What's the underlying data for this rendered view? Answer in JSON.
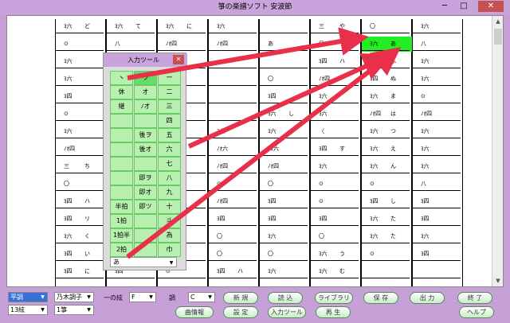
{
  "window": {
    "title": "箏の楽譜ソフト 安波節",
    "minimize": "─",
    "maximize": "□",
    "close": "✕"
  },
  "score": {
    "columns": [
      {
        "cells": [
          [
            "ﾖ六",
            "ど"
          ],
          [
            "⊙",
            ""
          ],
          [
            "ﾖ六",
            ""
          ],
          [
            "ﾖ六",
            ""
          ],
          [
            "ﾖ四",
            ""
          ],
          [
            "⊙",
            ""
          ],
          [
            "ﾖ六",
            ""
          ],
          [
            "ﾉｵ四",
            ""
          ],
          [
            "三",
            "ち"
          ],
          [
            "〇",
            ""
          ],
          [
            "ﾖ四",
            "ハ"
          ],
          [
            "ﾖ四",
            "リ"
          ],
          [
            "ﾖ六",
            "く"
          ],
          [
            "ﾖ四",
            "い"
          ],
          [
            "ﾖ四",
            "に"
          ]
        ]
      },
      {
        "cells": [
          [
            "ﾖ六",
            "て"
          ],
          [
            "八",
            ""
          ],
          [
            "ﾖ六",
            ""
          ],
          [
            "",
            ""
          ],
          [
            "",
            ""
          ],
          [
            "",
            ""
          ],
          [
            "",
            ""
          ],
          [
            "",
            ""
          ],
          [
            "",
            ""
          ],
          [
            "",
            ""
          ],
          [
            "",
            ""
          ],
          [
            "",
            ""
          ],
          [
            "",
            ""
          ],
          [
            "",
            ""
          ],
          [
            "ﾖ四",
            ""
          ]
        ]
      },
      {
        "cells": [
          [
            "ﾖ六",
            "に"
          ],
          [
            "ﾉｵ四",
            ""
          ],
          [
            "ﾖ六",
            ""
          ],
          [
            "ﾖ四",
            ""
          ],
          [
            "ﾖ四",
            ""
          ],
          [
            "",
            ""
          ],
          [
            "ﾖ四",
            ""
          ],
          [
            "",
            ""
          ],
          [
            "〈",
            ""
          ],
          [
            "⊙",
            ""
          ],
          [
            "⊙",
            ""
          ],
          [
            "ﾖ六",
            ""
          ],
          [
            "ﾖ六",
            ""
          ],
          [
            "⊙",
            ""
          ],
          [
            "⊙",
            ""
          ]
        ]
      },
      {
        "cells": [
          [
            "ﾖ六",
            ""
          ],
          [
            "ﾉｵ四",
            ""
          ],
          [
            "",
            ""
          ],
          [
            "",
            ""
          ],
          [
            "",
            ""
          ],
          [
            "",
            ""
          ],
          [
            "ﾖ六",
            ""
          ],
          [
            "ﾉｵ六",
            ""
          ],
          [
            "ﾉｵ四",
            ""
          ],
          [
            "⊙",
            ""
          ],
          [
            "ﾉｵ四",
            ""
          ],
          [
            "ﾖ四",
            ""
          ],
          [
            "〇",
            ""
          ],
          [
            "〇",
            ""
          ],
          [
            "ﾖ四",
            "ハ"
          ]
        ]
      },
      {
        "cells": [
          [
            "",
            ""
          ],
          [
            "あ",
            ""
          ],
          [
            "",
            ""
          ],
          [
            "〇",
            ""
          ],
          [
            "ﾖ四",
            ""
          ],
          [
            "ﾖ六",
            "し"
          ],
          [
            "ﾖ六",
            ""
          ],
          [
            "ﾉｵ六",
            ""
          ],
          [
            "ﾉｵ四",
            ""
          ],
          [
            "〇",
            ""
          ],
          [
            "ﾖ四",
            ""
          ],
          [
            "ﾖ四",
            ""
          ],
          [
            "ﾖ六",
            ""
          ],
          [
            "〇",
            ""
          ],
          [
            "ﾖ六",
            ""
          ]
        ]
      },
      {
        "cells": [
          [
            "三",
            "や"
          ],
          [
            "〇",
            ""
          ],
          [
            "ﾖ四",
            "ハ"
          ],
          [
            "ﾉｵ四",
            ""
          ],
          [
            "ﾖ六",
            ""
          ],
          [
            "ﾖ六",
            ""
          ],
          [
            "〈",
            ""
          ],
          [
            "ﾖ四",
            "す"
          ],
          [
            "ﾖ六",
            ""
          ],
          [
            "⊙",
            ""
          ],
          [
            "⊙",
            ""
          ],
          [
            "ﾖ四",
            ""
          ],
          [
            "〇",
            ""
          ],
          [
            "ﾖ六",
            "う"
          ],
          [
            "ﾖ六",
            "む"
          ]
        ]
      },
      {
        "cells": [
          [
            "〇",
            ""
          ],
          [
            "ﾖ六",
            "あ"
          ],
          [
            "ﾖ六",
            "ふ"
          ],
          [
            "ﾖ四",
            "ぬ"
          ],
          [
            "ﾖ六",
            "ま"
          ],
          [
            "ﾉｵ四",
            "は"
          ],
          [
            "ﾖ六",
            "つ"
          ],
          [
            "ﾖ六",
            "え"
          ],
          [
            "ﾖ六",
            "ん"
          ],
          [
            "⊙",
            ""
          ],
          [
            "ﾖ四",
            "し"
          ],
          [
            "ﾖ六",
            "た"
          ],
          [
            "ﾖ六",
            "た"
          ],
          [
            "⊙",
            ""
          ],
          [
            "",
            ""
          ]
        ]
      },
      {
        "cells": [
          [
            "ﾖ六",
            ""
          ],
          [
            "八",
            ""
          ],
          [
            "ﾖ六",
            ""
          ],
          [
            "ﾖ六",
            ""
          ],
          [
            "⊙",
            ""
          ],
          [
            "ﾉｵ四",
            ""
          ],
          [
            "ﾖ六",
            ""
          ],
          [
            "ﾖ六",
            ""
          ],
          [
            "ﾖ六",
            ""
          ],
          [
            "八",
            ""
          ],
          [
            "ﾖ四",
            ""
          ],
          [
            "ﾖ四",
            ""
          ],
          [
            "ﾖ六",
            ""
          ],
          [
            "ﾖ四",
            ""
          ],
          [
            "",
            ""
          ]
        ]
      }
    ],
    "highlight_note": "ﾖ六  あ"
  },
  "tool_panel": {
    "title": "入力ツール",
    "close": "✕",
    "grid": [
      [
        "ヽ",
        "ヲ",
        "一"
      ],
      [
        "休",
        "オ",
        "二"
      ],
      [
        "継",
        "ﾉオ",
        "三"
      ],
      [
        "",
        "",
        "四"
      ],
      [
        "",
        "後ヲ",
        "五"
      ],
      [
        "",
        "後オ",
        "六"
      ],
      [
        "",
        "",
        "七"
      ],
      [
        "",
        "即ヲ",
        "八"
      ],
      [
        "",
        "即オ",
        "九"
      ],
      [
        "半拍",
        "即ツ",
        "十"
      ],
      [
        "1拍",
        "",
        "斗"
      ],
      [
        "1拍半",
        "",
        "為"
      ],
      [
        "2拍",
        "",
        "巾"
      ]
    ],
    "select_value": "あ",
    "dropdown_icon": "▼"
  },
  "controls": {
    "tuning": "平調",
    "strings": "13絃",
    "pitch": "乃木調子",
    "koto": "1箏",
    "string_one_label": "一の絃",
    "string_one_value": "F",
    "key_label": "調",
    "key_value": "C",
    "dropdown_icon": "▼"
  },
  "buttons": {
    "new": "新 規",
    "load": "読 込",
    "library": "ライブラリ",
    "save": "保 存",
    "output": "出 力",
    "exit": "終 了",
    "song_info": "曲情報",
    "settings": "設 定",
    "input_tool": "入力ツール",
    "play": "再 生",
    "help": "ヘルプ"
  },
  "colors": {
    "highlight": "#22ee22",
    "arrow": "#e8304a",
    "tool_cell": "#b8f0b0",
    "title_bar": "#c9a4dc"
  }
}
